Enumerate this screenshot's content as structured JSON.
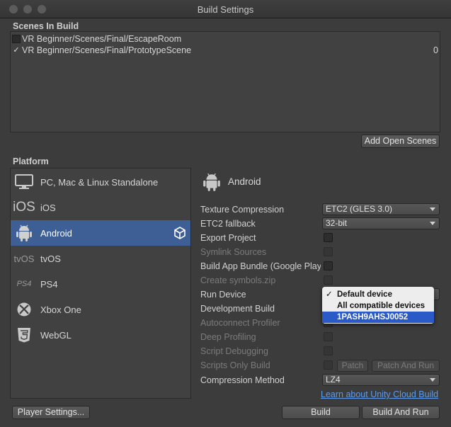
{
  "window": {
    "title": "Build Settings"
  },
  "scenes": {
    "header": "Scenes In Build",
    "items": [
      {
        "name": "VR Beginner/Scenes/Final/EscapeRoom",
        "checked": false,
        "index": ""
      },
      {
        "name": "VR Beginner/Scenes/Final/PrototypeScene",
        "checked": true,
        "check_glyph": "✓",
        "index": "0"
      }
    ],
    "add_open_scenes": "Add Open Scenes"
  },
  "platform": {
    "header": "Platform",
    "items": [
      {
        "label": "PC, Mac & Linux Standalone",
        "icon": "monitor-icon"
      },
      {
        "label": "iOS",
        "icon": "ios-icon",
        "icon_text": "iOS"
      },
      {
        "label": "Android",
        "icon": "android-icon",
        "selected": true
      },
      {
        "label": "tvOS",
        "icon": "tvos-icon",
        "icon_text": "tvOS"
      },
      {
        "label": "PS4",
        "icon": "ps4-icon",
        "icon_text": "PS4"
      },
      {
        "label": "Xbox One",
        "icon": "xbox-icon"
      },
      {
        "label": "WebGL",
        "icon": "html5-icon"
      }
    ]
  },
  "settings": {
    "platform_title": "Android",
    "texture_compression": {
      "label": "Texture Compression",
      "value": "ETC2 (GLES 3.0)"
    },
    "etc2_fallback": {
      "label": "ETC2 fallback",
      "value": "32-bit"
    },
    "export_project": "Export Project",
    "symlink_sources": "Symlink Sources",
    "build_app_bundle": "Build App Bundle (Google Play)",
    "create_symbols": "Create symbols.zip",
    "run_device": "Run Device",
    "development_build": "Development Build",
    "autoconnect_profiler": "Autoconnect Profiler",
    "deep_profiling": "Deep Profiling",
    "script_debugging": "Script Debugging",
    "scripts_only_build": "Scripts Only Build",
    "patch": "Patch",
    "patch_and_run": "Patch And Run",
    "compression_method": {
      "label": "Compression Method",
      "value": "LZ4"
    },
    "cloud_build_link": "Learn about Unity Cloud Build"
  },
  "run_device_popup": {
    "items": [
      {
        "label": "Default device",
        "checked": true,
        "check_glyph": "✓"
      },
      {
        "label": "All compatible devices",
        "checked": false
      },
      {
        "label": "1PASH9AHSJ0052",
        "highlighted": true
      }
    ]
  },
  "footer": {
    "player_settings": "Player Settings...",
    "build": "Build",
    "build_and_run": "Build And Run"
  },
  "colors": {
    "window_bg": "#3c3c3c",
    "selection": "#3e5f96",
    "link": "#5d9cec",
    "popup_highlight": "#2a5ac8"
  }
}
